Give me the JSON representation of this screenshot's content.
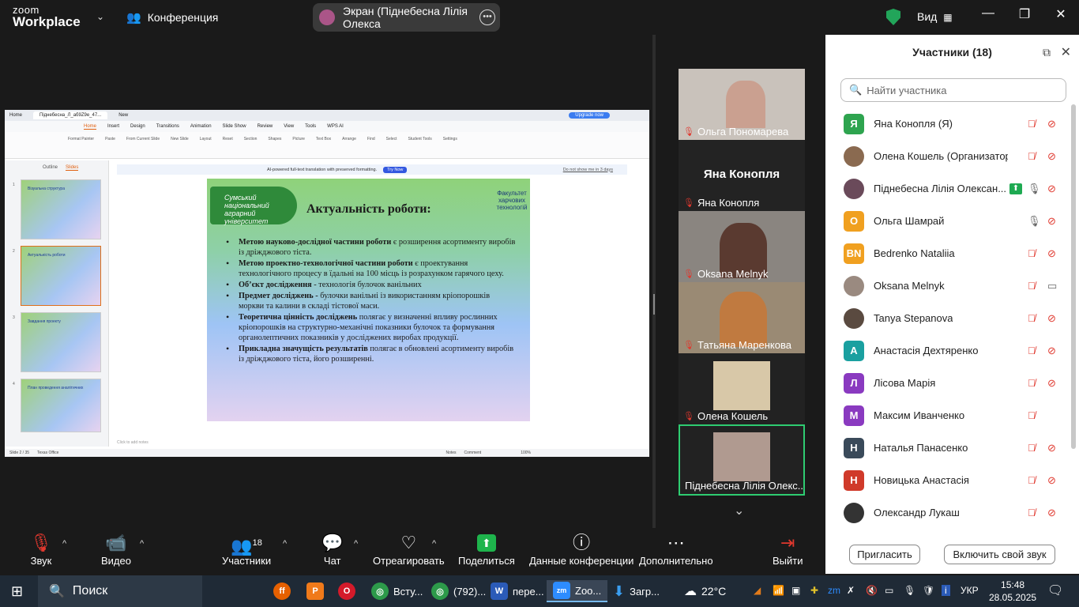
{
  "topbar": {
    "logo_top": "zoom",
    "logo_bottom": "Workplace",
    "meeting_label": "Конференция",
    "share_label": "Экран (Піднебесна Лілія Олекса",
    "view_label": "Вид"
  },
  "slide_app": {
    "home_tab": "Home",
    "doc_tab": "Піднебесна_Л_аб9Z9e_47...",
    "new_tab": "New",
    "sign_in": "Sign in",
    "upgrade": "Upgrade now",
    "menu_items": [
      "Menu",
      "Home",
      "Insert",
      "Design",
      "Transitions",
      "Animation",
      "Slide Show",
      "Review",
      "View",
      "Tools",
      "WPS AI"
    ],
    "share_btn": "Share",
    "ribbon": [
      "Format Painter",
      "Paste",
      "From Current Slide",
      "New Slide",
      "Layout",
      "Reset",
      "Section",
      "Shapes",
      "Picture",
      "Text Box",
      "Arrange",
      "Find",
      "Select",
      "Student Tools",
      "Settings"
    ],
    "thumb_tabs": [
      "Outline",
      "Slides"
    ],
    "notice": "AI-powered full-text translation with preserved formatting.",
    "try_now": "Try Now",
    "dont_show": "Do not show me in 3 days",
    "notes_placeholder": "Click to add notes",
    "status": {
      "slide": "Slide 2 / 35",
      "theme": "Texas Office",
      "notes": "Notes",
      "comment": "Comment",
      "zoom": "100%"
    },
    "thumbnails": [
      {
        "num": "1",
        "title": "Візуальна структура"
      },
      {
        "num": "2",
        "title": "Актуальність роботи"
      },
      {
        "num": "3",
        "title": "Завдання проекту"
      },
      {
        "num": "4",
        "title": "План проведення аналітичних"
      }
    ]
  },
  "slide": {
    "university": "Сумський національний аграрний університет",
    "title": "Актуальність роботи:",
    "faculty": "Факультет харчових технологій",
    "bullets": [
      {
        "bold": "Метою науково-дослідної частини роботи",
        "text": " є розширення асортименту виробів із дріжджового тіста."
      },
      {
        "bold": "Метою проектно-технологічної частини роботи",
        "text": "  є проектування технологічного процесу в їдальні на 100 місць із розрахунком гарячого цеху."
      },
      {
        "bold": "Об’єкт дослідження",
        "text": " - технологія булочок ванільних"
      },
      {
        "bold": "Предмет досліджень -",
        "text": "  булочки ванільні із використанням кріопорошків моркви та калини в складі тістової маси."
      },
      {
        "bold": "Теоретична цінність досліджень",
        "text": " полягає у визначенні впливу рослинних кріопорошків на структурно-механічні показники булочок та формування органолептичних показників  у досліджених виробах продукції."
      },
      {
        "bold": "Прикладна значущість результатів",
        "text": " полягає в обновлені асортименту виробів із дріжджового тіста, його розширенні."
      }
    ]
  },
  "gallery": [
    {
      "name": "Ольга Пономарева"
    },
    {
      "name": "Яна Конопля",
      "big": "Яна Конопля"
    },
    {
      "name": "Oksana Melnyk"
    },
    {
      "name": "Татьяна Маренкова"
    },
    {
      "name": "Олена Кошель"
    },
    {
      "name": "Піднебесна Лілія Олекс..."
    }
  ],
  "panel": {
    "title": "Участники (18)",
    "search_placeholder": "Найти участника",
    "invite": "Пригласить",
    "unmute": "Включить свой звук",
    "participants": [
      {
        "initial": "Я",
        "color": "#2ea44f",
        "name": "Яна Конопля (Я)",
        "mic": "muted",
        "cam": "off"
      },
      {
        "initial": "",
        "color": "#8a6a50",
        "name": "Олена Кошель (Организатор)",
        "mic": "muted",
        "cam": "off"
      },
      {
        "initial": "",
        "color": "#6a4a5a",
        "name": "Піднебесна Лілія Олексан...",
        "mic": "on",
        "cam": "off",
        "sharing": true
      },
      {
        "initial": "О",
        "color": "#f0a020",
        "name": "Ольга Шамрай",
        "mic": "on",
        "cam": "off"
      },
      {
        "initial": "BN",
        "color": "#f0a020",
        "name": "Bedrenko Nataliia",
        "mic": "muted",
        "cam": "off"
      },
      {
        "initial": "",
        "color": "#9a8a80",
        "name": "Oksana Melnyk",
        "mic": "muted",
        "cam": "on"
      },
      {
        "initial": "",
        "color": "#5a4a40",
        "name": "Tanya Stepanova",
        "mic": "muted",
        "cam": "off"
      },
      {
        "initial": "А",
        "color": "#1aa0a0",
        "name": "Анастасія Дехтяренко",
        "mic": "muted",
        "cam": "off"
      },
      {
        "initial": "Л",
        "color": "#8a3ac0",
        "name": "Лісова Марія",
        "mic": "muted",
        "cam": "off"
      },
      {
        "initial": "М",
        "color": "#8a3ac0",
        "name": "Максим Иванченко",
        "mic": "muted",
        "cam": ""
      },
      {
        "initial": "Н",
        "color": "#3a4a5a",
        "name": "Наталья Панасенко",
        "mic": "muted",
        "cam": "off"
      },
      {
        "initial": "Н",
        "color": "#d03a2a",
        "name": "Новицька Анастасія",
        "mic": "muted",
        "cam": "off"
      },
      {
        "initial": "",
        "color": "#333333",
        "name": "Олександр Лукаш",
        "mic": "muted",
        "cam": "off"
      }
    ]
  },
  "controls": {
    "audio": "Звук",
    "video": "Видео",
    "participants": "Участники",
    "participants_count": "18",
    "chat": "Чат",
    "react": "Отреагировать",
    "share": "Поделиться",
    "info": "Данные конференции",
    "more": "Дополнительно",
    "leave": "Выйти"
  },
  "taskbar": {
    "search": "Поиск",
    "items": [
      {
        "label": "Всту...",
        "icon": "chrome"
      },
      {
        "label": "(792)...",
        "icon": "chrome"
      },
      {
        "label": "пере...",
        "icon": "word"
      },
      {
        "label": "Zoo...",
        "icon": "zoom"
      },
      {
        "label": "Загр...",
        "icon": "download"
      }
    ],
    "weather": "22°C",
    "lang": "УКР",
    "time": "15:48",
    "date": "28.05.2025"
  },
  "colors": {
    "accent_green": "#1eb44c",
    "muted_red": "#e0382e",
    "slide_title_blue": "#1a3a99"
  }
}
